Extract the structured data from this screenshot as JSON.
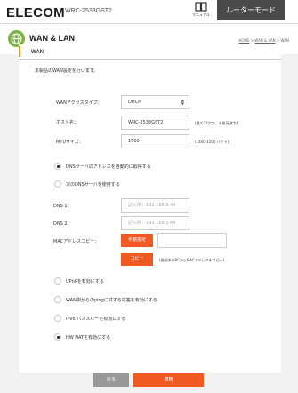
{
  "header": {
    "logo": "ELECOM",
    "model": "WRC-2533GST2",
    "manual_label": "マニュアル",
    "mode_button": "ルーターモード"
  },
  "page": {
    "title": "WAN & LAN",
    "breadcrumb": {
      "home": "HOME",
      "sep": ">",
      "parent": "WAN & LAN",
      "current": "WAN"
    },
    "section_tab": "WAN",
    "description": "本製品のWAN設定を行います。"
  },
  "form": {
    "wan_access_type": {
      "label": "WANアクセスタイプ：",
      "value": "DHCP"
    },
    "host_name": {
      "label": "ホスト名：",
      "value": "WRC-2533GST2",
      "hint": "(最大32文字、半角英数字)"
    },
    "mtu": {
      "label": "MTUサイズ：",
      "value": "1500",
      "hint": "(1400-1500 バイト)"
    },
    "dns_auto": {
      "label": "DNSサーバのアドレスを自動的に取得する",
      "checked": true
    },
    "dns_manual": {
      "label": "次のDNSサーバを使用する",
      "checked": false
    },
    "dns1": {
      "label": "DNS 1：",
      "placeholder": "記入例：192.168.3.44"
    },
    "dns2": {
      "label": "DNS 2：",
      "placeholder": "記入例：192.168.3.44"
    },
    "mac_clone": {
      "label": "MACアドレスコピー：",
      "manual_button": "手動指定",
      "copy_button": "コピー",
      "copy_hint": "(接続中のPCからMACアドレスをコピー)"
    },
    "upnp": {
      "label": "UPnPを有効にする",
      "checked": false
    },
    "wan_ping": {
      "label": "WAN側からのpingに対する応答を有効にする",
      "checked": false
    },
    "ipv6_passthrough": {
      "label": "IPv6 パススルーを有効にする",
      "checked": false
    },
    "hw_nat": {
      "label": "HW NATを有効にする",
      "checked": true
    }
  },
  "footer": {
    "back_button": "戻る",
    "apply_button": "適用"
  },
  "colors": {
    "accent_orange": "#f05a22",
    "section_bar": "#f39c12",
    "globe_green": "#7cb342",
    "mode_button_bg": "#4a4a4a"
  }
}
